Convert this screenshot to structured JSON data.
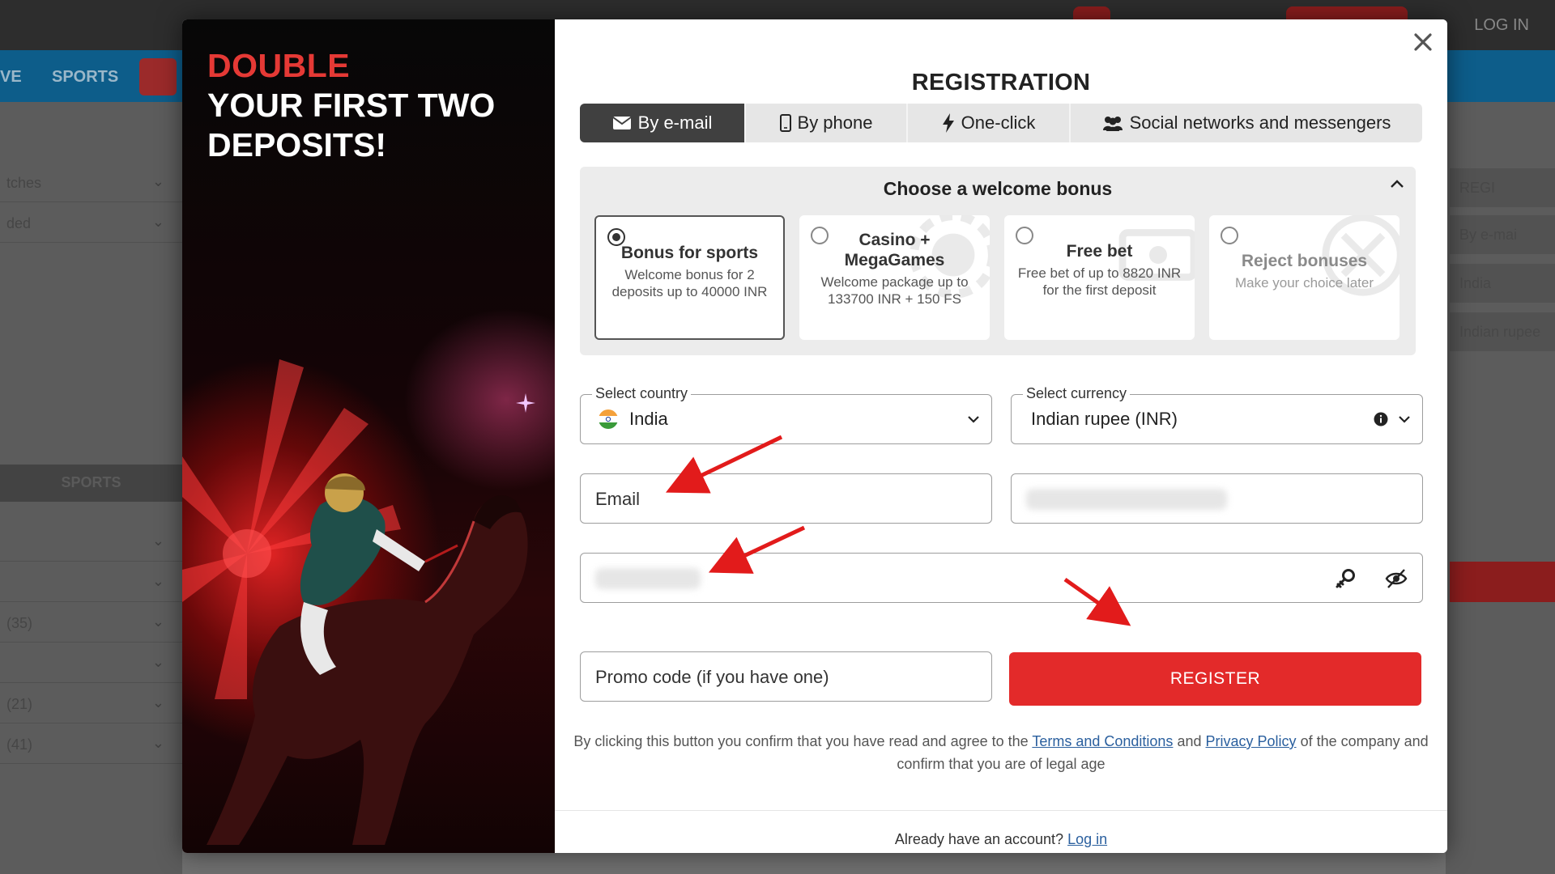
{
  "background": {
    "nav_items": [
      "VE",
      "SPORTS"
    ],
    "login_text": "LOG IN",
    "sidebar_rows": [
      "tches",
      "ded",
      "",
      "",
      "(35)",
      "",
      "(21)",
      "(41)"
    ],
    "sports_label": "SPORTS",
    "right_boxes": [
      "REGI",
      "By e-mai",
      "India",
      "Indian rupee"
    ]
  },
  "promo": {
    "title_red": "DOUBLE",
    "title_white": "YOUR FIRST TWO DEPOSITS!"
  },
  "modal": {
    "title": "REGISTRATION",
    "close_icon": "close-icon",
    "tabs": [
      {
        "label": "By e-mail",
        "icon": "envelope-icon",
        "active": true
      },
      {
        "label": "By phone",
        "icon": "phone-icon",
        "active": false
      },
      {
        "label": "One-click",
        "icon": "lightning-icon",
        "active": false
      },
      {
        "label": "Social networks and messengers",
        "icon": "users-icon",
        "active": false
      }
    ],
    "bonus": {
      "header": "Choose a welcome bonus",
      "cards": [
        {
          "title": "Bonus for sports",
          "desc": "Welcome bonus for 2 deposits up to 40000 INR",
          "selected": true
        },
        {
          "title": "Casino + MegaGames",
          "desc": "Welcome package up to 133700 INR + 150 FS",
          "selected": false
        },
        {
          "title": "Free bet",
          "desc": "Free bet of up to 8820 INR for the first deposit",
          "selected": false
        },
        {
          "title": "Reject bonuses",
          "desc": "Make your choice later",
          "selected": false
        }
      ]
    },
    "country": {
      "legend": "Select country",
      "value": "India"
    },
    "currency": {
      "legend": "Select currency",
      "value": "Indian rupee (INR)"
    },
    "email": {
      "placeholder": "Email"
    },
    "promo_code": {
      "placeholder": "Promo code (if you have one)"
    },
    "register_label": "REGISTER",
    "legal": {
      "prefix": "By clicking this button you confirm that you have read and agree to the",
      "terms": "Terms and Conditions",
      "and": "and",
      "privacy": "Privacy Policy",
      "suffix": "of the company and confirm that you are of legal age"
    },
    "login": {
      "prefix": "Already have an account?",
      "link": "Log in"
    }
  },
  "colors": {
    "accent_red": "#e32a2a",
    "title_red": "#e53935",
    "link_blue": "#2a5f9e",
    "active_tab": "#404040"
  }
}
